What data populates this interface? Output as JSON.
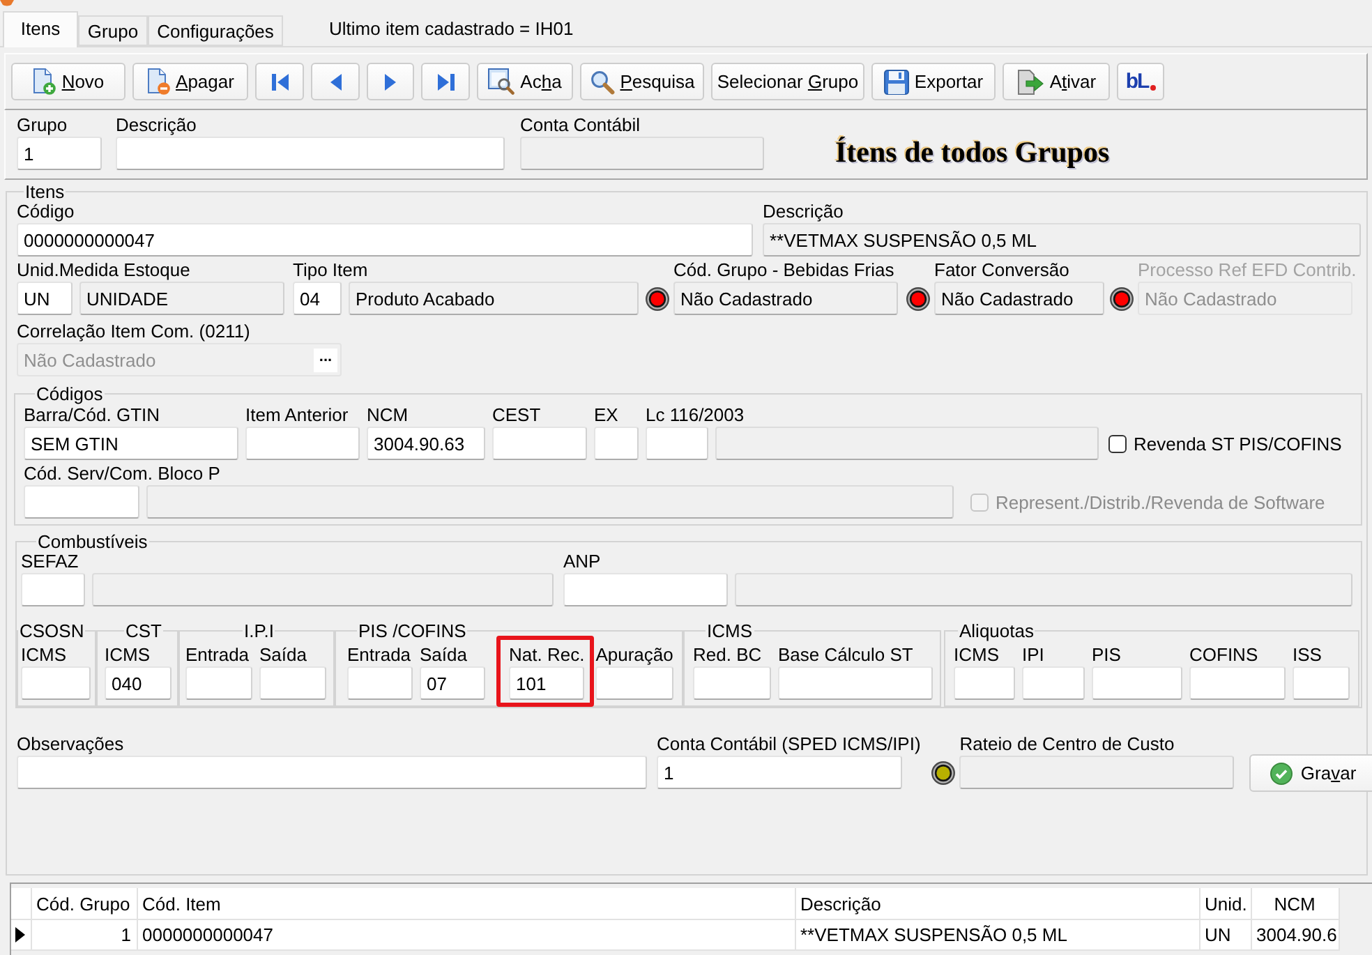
{
  "tabs": [
    {
      "label": "Itens",
      "selected": true
    },
    {
      "label": "Grupo",
      "selected": false
    },
    {
      "label": "Configurações",
      "selected": false
    }
  ],
  "status_text": "Ultimo item cadastrado = IH01",
  "toolbar": [
    {
      "kind": "new",
      "label": "Novo"
    },
    {
      "kind": "delete",
      "label": "Apagar"
    },
    {
      "kind": "first"
    },
    {
      "kind": "previous"
    },
    {
      "kind": "next"
    },
    {
      "kind": "last"
    },
    {
      "kind": "find",
      "label": "Acha"
    },
    {
      "kind": "search",
      "label": "Pesquisa"
    },
    {
      "kind": "plain",
      "label": "Selecionar Grupo"
    },
    {
      "kind": "export",
      "label": "Exportar"
    },
    {
      "kind": "activate",
      "label": "Ativar"
    },
    {
      "kind": "logo",
      "label": "bL"
    }
  ],
  "header": {
    "fields": [
      {
        "kind": "field",
        "label": "Grupo",
        "disabled": false,
        "inputs": [
          {
            "value": "1",
            "readonly": false,
            "disabled": false
          }
        ]
      },
      {
        "kind": "field",
        "label": "Descrição",
        "disabled": false,
        "inputs": [
          {
            "readonly": false,
            "disabled": false
          }
        ]
      },
      {
        "kind": "field",
        "label": "Conta Contábil",
        "disabled": false,
        "inputs": [
          {
            "readonly": true,
            "disabled": false
          }
        ]
      }
    ],
    "title": "Ítens de todos Grupos"
  },
  "itens": {
    "legend": "Itens",
    "lines": [
      {
        "fields": [
          {
            "kind": "field",
            "label": "Código",
            "disabled": false,
            "inputs": [
              {
                "value": "0000000000047",
                "readonly": false,
                "disabled": false
              }
            ]
          },
          {
            "kind": "field",
            "label": "Descrição",
            "disabled": false,
            "inputs": [
              {
                "value": "**VETMAX SUSPENSÃO 0,5 ML",
                "readonly": true,
                "disabled": false
              }
            ]
          }
        ]
      },
      {
        "fields": [
          {
            "kind": "field",
            "label": "Unid.Medida Estoque",
            "disabled": false,
            "inputs": [
              {
                "value": "UN",
                "readonly": false,
                "disabled": false
              },
              {
                "value": "UNIDADE",
                "readonly": true,
                "disabled": false
              }
            ]
          },
          {
            "kind": "field",
            "label": "Tipo Item",
            "disabled": false,
            "inputs": [
              {
                "value": "04",
                "readonly": false,
                "disabled": false
              },
              {
                "value": "Produto Acabado",
                "readonly": true,
                "disabled": false
              }
            ]
          },
          {
            "kind": "field",
            "label": "Cód. Grupo - Bebidas Frias",
            "disabled": false,
            "indicator": {
              "color": "#ff0000"
            },
            "inputs": [
              {
                "value": "Não Cadastrado",
                "readonly": true,
                "disabled": false
              }
            ]
          },
          {
            "kind": "field",
            "label": "Fator Conversão",
            "disabled": false,
            "indicator": {
              "color": "#ff0000"
            },
            "inputs": [
              {
                "value": "Não Cadastrado",
                "readonly": true,
                "disabled": false
              }
            ]
          },
          {
            "kind": "field",
            "label": "Processo Ref EFD Contrib.",
            "disabled": true,
            "indicator": {
              "color": "#ff0000"
            },
            "inputs": [
              {
                "value": "Não Cadastrado",
                "readonly": true,
                "disabled": true
              }
            ]
          }
        ]
      },
      {
        "fields": [
          {
            "kind": "field",
            "label": "Correlação Item Com. (0211)",
            "disabled": false,
            "inputs": [
              {
                "value": "Não Cadastrado",
                "readonly": true,
                "disabled": true,
                "button": "..."
              }
            ]
          }
        ]
      }
    ],
    "codigos": {
      "legend": "Códigos",
      "lines": [
        {
          "fields": [
            {
              "kind": "field",
              "label": "Barra/Cód. GTIN",
              "disabled": false,
              "inputs": [
                {
                  "value": "SEM GTIN",
                  "readonly": false,
                  "disabled": false
                }
              ]
            },
            {
              "kind": "field",
              "label": "Item Anterior",
              "disabled": false,
              "inputs": [
                {
                  "readonly": false,
                  "disabled": false
                }
              ]
            },
            {
              "kind": "field",
              "label": "NCM",
              "disabled": false,
              "inputs": [
                {
                  "value": "3004.90.63",
                  "readonly": false,
                  "disabled": false
                }
              ]
            },
            {
              "kind": "field",
              "label": "CEST",
              "disabled": false,
              "inputs": [
                {
                  "readonly": false,
                  "disabled": false
                }
              ]
            },
            {
              "kind": "field",
              "label": "EX",
              "disabled": false,
              "inputs": [
                {
                  "readonly": false,
                  "disabled": false
                }
              ]
            },
            {
              "kind": "field",
              "label": "Lc 116/2003",
              "disabled": false,
              "inputs": [
                {
                  "readonly": false,
                  "disabled": false
                },
                {
                  "readonly": true,
                  "disabled": false
                }
              ]
            },
            {
              "kind": "checkbox",
              "label": "Revenda ST PIS/COFINS",
              "checked": false,
              "disabled": false
            }
          ]
        },
        {
          "fields": [
            {
              "kind": "field",
              "label": "Cód. Serv/Com. Bloco P",
              "disabled": false,
              "inputs": [
                {
                  "readonly": false,
                  "disabled": false
                },
                {
                  "readonly": true,
                  "disabled": false
                }
              ]
            },
            {
              "kind": "checkbox",
              "label": "Represent./Distrib./Revenda de Software",
              "checked": false,
              "disabled": true
            }
          ]
        }
      ]
    },
    "combustiveis": {
      "legend": "Combustíveis",
      "lines": [
        {
          "fields": [
            {
              "kind": "field",
              "label": "SEFAZ",
              "disabled": false,
              "inputs": [
                {
                  "readonly": false,
                  "disabled": false
                },
                {
                  "readonly": true,
                  "disabled": false
                }
              ]
            },
            {
              "kind": "field",
              "label": "ANP",
              "disabled": false,
              "inputs": [
                {
                  "readonly": false,
                  "disabled": false
                },
                {
                  "readonly": true,
                  "disabled": false
                }
              ]
            }
          ]
        }
      ],
      "tax_groups": [
        {
          "legend": "CSOSN",
          "fields": [
            {
              "kind": "field",
              "label": "ICMS",
              "disabled": false,
              "highlighted": false,
              "inputs": [
                {
                  "readonly": false,
                  "disabled": false
                }
              ]
            }
          ]
        },
        {
          "legend": "CST",
          "fields": [
            {
              "kind": "field",
              "label": "ICMS",
              "disabled": false,
              "highlighted": false,
              "inputs": [
                {
                  "value": "040",
                  "readonly": false,
                  "disabled": false
                }
              ]
            }
          ]
        },
        {
          "legend": "I.P.I",
          "fields": [
            {
              "kind": "field",
              "label": "Entrada",
              "disabled": false,
              "highlighted": false,
              "inputs": [
                {
                  "readonly": false,
                  "disabled": false
                }
              ]
            },
            {
              "kind": "field",
              "label": "Saída",
              "disabled": false,
              "highlighted": false,
              "inputs": [
                {
                  "readonly": false,
                  "disabled": false
                }
              ]
            }
          ]
        },
        {
          "legend": "PIS /COFINS",
          "fields": [
            {
              "kind": "field",
              "label": "Entrada",
              "disabled": false,
              "highlighted": false,
              "inputs": [
                {
                  "readonly": false,
                  "disabled": false
                }
              ]
            },
            {
              "kind": "field",
              "label": "Saída",
              "disabled": false,
              "highlighted": false,
              "inputs": [
                {
                  "value": "07",
                  "readonly": false,
                  "disabled": false
                }
              ]
            },
            {
              "kind": "field",
              "label": "Nat. Rec.",
              "disabled": false,
              "highlighted": true,
              "inputs": [
                {
                  "value": "101",
                  "readonly": false,
                  "disabled": false
                }
              ]
            },
            {
              "kind": "field",
              "label": "Apuração",
              "disabled": false,
              "highlighted": false,
              "inputs": [
                {
                  "readonly": false,
                  "disabled": false
                }
              ]
            }
          ]
        },
        {
          "legend": "ICMS",
          "fields": [
            {
              "kind": "field",
              "label": "Red. BC",
              "disabled": false,
              "highlighted": false,
              "inputs": [
                {
                  "readonly": false,
                  "disabled": false
                }
              ]
            },
            {
              "kind": "field",
              "label": "Base Cálculo ST",
              "disabled": false,
              "highlighted": false,
              "inputs": [
                {
                  "readonly": false,
                  "disabled": false
                }
              ]
            }
          ]
        },
        {
          "legend": "Aliquotas",
          "fields": [
            {
              "kind": "field",
              "label": "ICMS",
              "disabled": false,
              "highlighted": false,
              "inputs": [
                {
                  "readonly": false,
                  "disabled": false
                }
              ]
            },
            {
              "kind": "field",
              "label": "IPI",
              "disabled": false,
              "highlighted": false,
              "inputs": [
                {
                  "readonly": false,
                  "disabled": false
                }
              ]
            },
            {
              "kind": "field",
              "label": "PIS",
              "disabled": false,
              "highlighted": false,
              "inputs": [
                {
                  "readonly": false,
                  "disabled": false
                }
              ]
            },
            {
              "kind": "field",
              "label": "COFINS",
              "disabled": false,
              "highlighted": false,
              "inputs": [
                {
                  "readonly": false,
                  "disabled": false
                }
              ]
            },
            {
              "kind": "field",
              "label": "ISS",
              "disabled": false,
              "highlighted": false,
              "inputs": [
                {
                  "readonly": false,
                  "disabled": false
                }
              ]
            }
          ]
        }
      ]
    },
    "bottom_line": {
      "fields": [
        {
          "kind": "field",
          "label": "Observações",
          "disabled": false,
          "inputs": [
            {
              "readonly": false,
              "disabled": false
            }
          ]
        },
        {
          "kind": "field",
          "label": "Conta Contábil (SPED ICMS/IPI)",
          "disabled": false,
          "inputs": [
            {
              "value": "1",
              "readonly": false,
              "disabled": false
            }
          ]
        },
        {
          "kind": "field",
          "label": "Rateio de Centro de Custo",
          "disabled": false,
          "indicator": {
            "color": "#b8b000"
          },
          "inputs": [
            {
              "readonly": true,
              "disabled": false
            }
          ]
        },
        {
          "kind": "button",
          "label": "Gravar"
        }
      ]
    }
  },
  "grid": {
    "columns": [
      "Cód. Grupo",
      "Cód. Item",
      "Descrição",
      "Unid.",
      "NCM"
    ],
    "rows": [
      {
        "selected": true,
        "cells": [
          "1",
          "0000000000047",
          "**VETMAX SUSPENSÃO 0,5 ML",
          "UN",
          "3004.90.6"
        ]
      }
    ]
  }
}
